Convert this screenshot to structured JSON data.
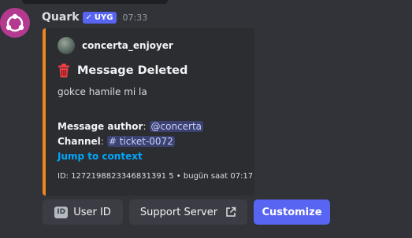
{
  "message": {
    "author": "Quark",
    "app_tag": "UYG",
    "app_tag_check": "✓",
    "timestamp": "07:33"
  },
  "embed": {
    "accent_color": "#f0861c",
    "author_name": "concerta_enjoyer",
    "title": "Message Deleted",
    "description": "gokce hamile mi la",
    "fields": {
      "message_author_label": "Message author",
      "message_author_value": "@concerta",
      "channel_label": "Channel",
      "channel_value": "# ticket-0072"
    },
    "jump_link": "Jump to context",
    "footer": "ID: 1272198823346831391 5 • bugün saat 07:17"
  },
  "buttons": {
    "user_id": "User ID",
    "support_server": "Support Server",
    "customize": "Customize"
  },
  "colors": {
    "background": "#323339",
    "embed_bg": "#2b2d31",
    "primary_button": "#5865f2",
    "link": "#00a8fc"
  },
  "icons": {
    "avatar": "quark-logo-icon",
    "title": "trash-icon",
    "user_id": "id-card-icon",
    "support_server": "external-link-icon"
  }
}
